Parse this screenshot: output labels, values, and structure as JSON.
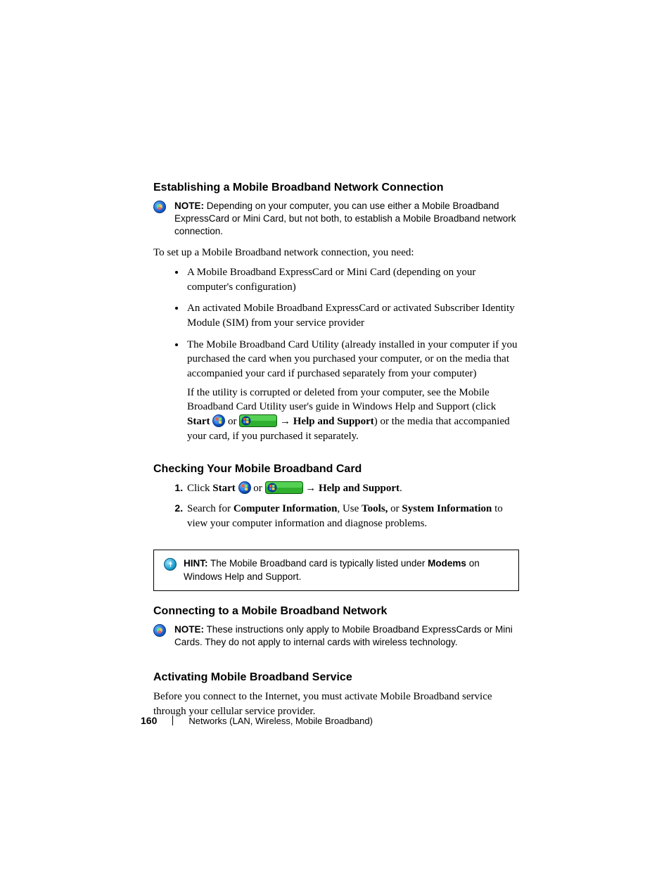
{
  "headings": {
    "h1": "Establishing a Mobile Broadband Network Connection",
    "h2": "Checking Your Mobile Broadband Card",
    "h3": "Connecting to a Mobile Broadband Network",
    "h4": "Activating Mobile Broadband Service"
  },
  "labels": {
    "note": "NOTE:",
    "hint": "HINT:",
    "start": "Start",
    "or": "or",
    "arrow": "→",
    "help_support": "Help and Support",
    "click": "Click",
    "period": ".",
    "tools": "Tools,",
    "sysinfo": "System Information",
    "compinfo": "Computer Information",
    "modems": "Modems"
  },
  "note1": {
    "text_after": " Depending on your computer, you can use either a Mobile Broadband ExpressCard or Mini Card, but not both, to establish a Mobile Broadband network connection."
  },
  "intro": "To set up a Mobile Broadband network connection, you need:",
  "bullets": {
    "b1": "A Mobile Broadband ExpressCard or Mini Card (depending on your computer's configuration)",
    "b2": "An activated Mobile Broadband ExpressCard or activated Subscriber Identity Module (SIM) from your service provider",
    "b3": "The Mobile Broadband Card Utility (already installed in your computer if you purchased the card when you purchased your computer, or on the media that accompanied your card if purchased separately from your computer)",
    "b3_p2_a": "If the utility is corrupted or deleted from your computer, see the Mobile Broadband Card Utility user's guide in Windows Help and Support (click ",
    "b3_p2_b": ") or the media that accompanied your card, if you purchased it separately."
  },
  "steps": {
    "s1_a": " ",
    "s2_a": "Search for ",
    "s2_b": ", Use ",
    "s2_c": " or ",
    "s2_d": " to view your computer information and diagnose problems."
  },
  "hint": {
    "text_a": " The Mobile Broadband card is typically listed under ",
    "text_b": " on Windows Help and Support."
  },
  "note2": {
    "text_after": " These instructions only apply to Mobile Broadband ExpressCards or Mini Cards. They do not apply to internal cards with wireless technology."
  },
  "activating_p": "Before you connect to the Internet, you must activate Mobile Broadband service through your cellular service provider.",
  "footer": {
    "page": "160",
    "chapter": "Networks (LAN, Wireless, Mobile Broadband)"
  }
}
